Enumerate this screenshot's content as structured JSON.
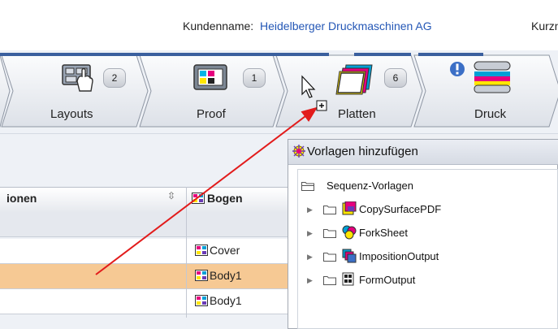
{
  "header": {
    "customer_label": "Kundenname:",
    "customer_name": "Heidelberger Druckmaschinen AG",
    "short_label": "Kurzn"
  },
  "workflow": {
    "steps": [
      {
        "label": "Layouts",
        "count": "2"
      },
      {
        "label": "Proof",
        "count": "1"
      },
      {
        "label": "Platten",
        "count": "6"
      },
      {
        "label": "Druck",
        "count": ""
      }
    ]
  },
  "grid": {
    "col1_header": "ionen",
    "col2_header": "Bogen",
    "rows": [
      "Cover",
      "Body1",
      "Body1"
    ]
  },
  "dialog": {
    "title": "Vorlagen hinzufügen",
    "root": "Sequenz-Vorlagen",
    "items": [
      "CopySurfacePDF",
      "ForkSheet",
      "ImpositionOutput",
      "FormOutput"
    ]
  },
  "colors": {
    "accent_blue": "#3a5f9e",
    "selection_orange": "#f6c994",
    "drag_arrow": "#e21b1b",
    "link_blue": "#2457b6"
  }
}
